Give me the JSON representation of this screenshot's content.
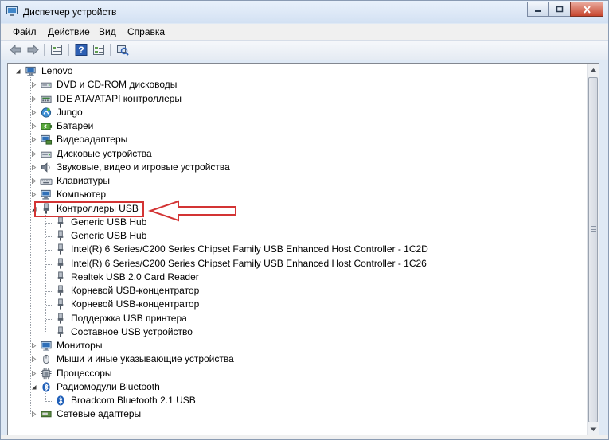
{
  "window": {
    "title": "Диспетчер устройств"
  },
  "menu": [
    {
      "label": "Файл"
    },
    {
      "label": "Действие"
    },
    {
      "label": "Вид"
    },
    {
      "label": "Справка"
    }
  ],
  "toolbar": [
    {
      "icon": "back-arrow-icon"
    },
    {
      "icon": "forward-arrow-icon"
    },
    {
      "icon": "properties-icon"
    },
    {
      "icon": "help-icon"
    },
    {
      "icon": "show-hidden-icon"
    },
    {
      "icon": "scan-hardware-icon"
    }
  ],
  "tree": {
    "root": "Lenovo",
    "categories": [
      {
        "label": "DVD и CD-ROM дисководы",
        "icon": "dvd-drive-icon",
        "expanded": false
      },
      {
        "label": "IDE ATA/ATAPI контроллеры",
        "icon": "ide-controller-icon",
        "expanded": false
      },
      {
        "label": "Jungo",
        "icon": "jungo-icon",
        "expanded": false
      },
      {
        "label": "Батареи",
        "icon": "battery-icon",
        "expanded": false
      },
      {
        "label": "Видеоадаптеры",
        "icon": "display-adapter-icon",
        "expanded": false
      },
      {
        "label": "Дисковые устройства",
        "icon": "disk-drive-icon",
        "expanded": false
      },
      {
        "label": "Звуковые, видео и игровые устройства",
        "icon": "sound-icon",
        "expanded": false
      },
      {
        "label": "Клавиатуры",
        "icon": "keyboard-icon",
        "expanded": false
      },
      {
        "label": "Компьютер",
        "icon": "computer-icon",
        "expanded": false
      },
      {
        "label": "Контроллеры USB",
        "icon": "usb-icon",
        "expanded": true,
        "children": [
          "Generic USB Hub",
          "Generic USB Hub",
          "Intel(R) 6 Series/C200 Series Chipset Family USB Enhanced Host Controller - 1C2D",
          "Intel(R) 6 Series/C200 Series Chipset Family USB Enhanced Host Controller - 1C26",
          "Realtek USB 2.0 Card Reader",
          "Корневой USB-концентратор",
          "Корневой USB-концентратор",
          "Поддержка USB принтера",
          "Составное USB устройство"
        ]
      },
      {
        "label": "Мониторы",
        "icon": "monitor-icon",
        "expanded": false
      },
      {
        "label": "Мыши и иные указывающие устройства",
        "icon": "mouse-icon",
        "expanded": false
      },
      {
        "label": "Процессоры",
        "icon": "processor-icon",
        "expanded": false
      },
      {
        "label": "Радиомодули Bluetooth",
        "icon": "bluetooth-icon",
        "expanded": true,
        "children": [
          "Broadcom Bluetooth 2.1 USB"
        ]
      },
      {
        "label": "Сетевые адаптеры",
        "icon": "network-adapter-icon",
        "expanded": false
      }
    ]
  },
  "colors": {
    "highlight": "#d33434",
    "window_frame": "#8a9bb3"
  }
}
